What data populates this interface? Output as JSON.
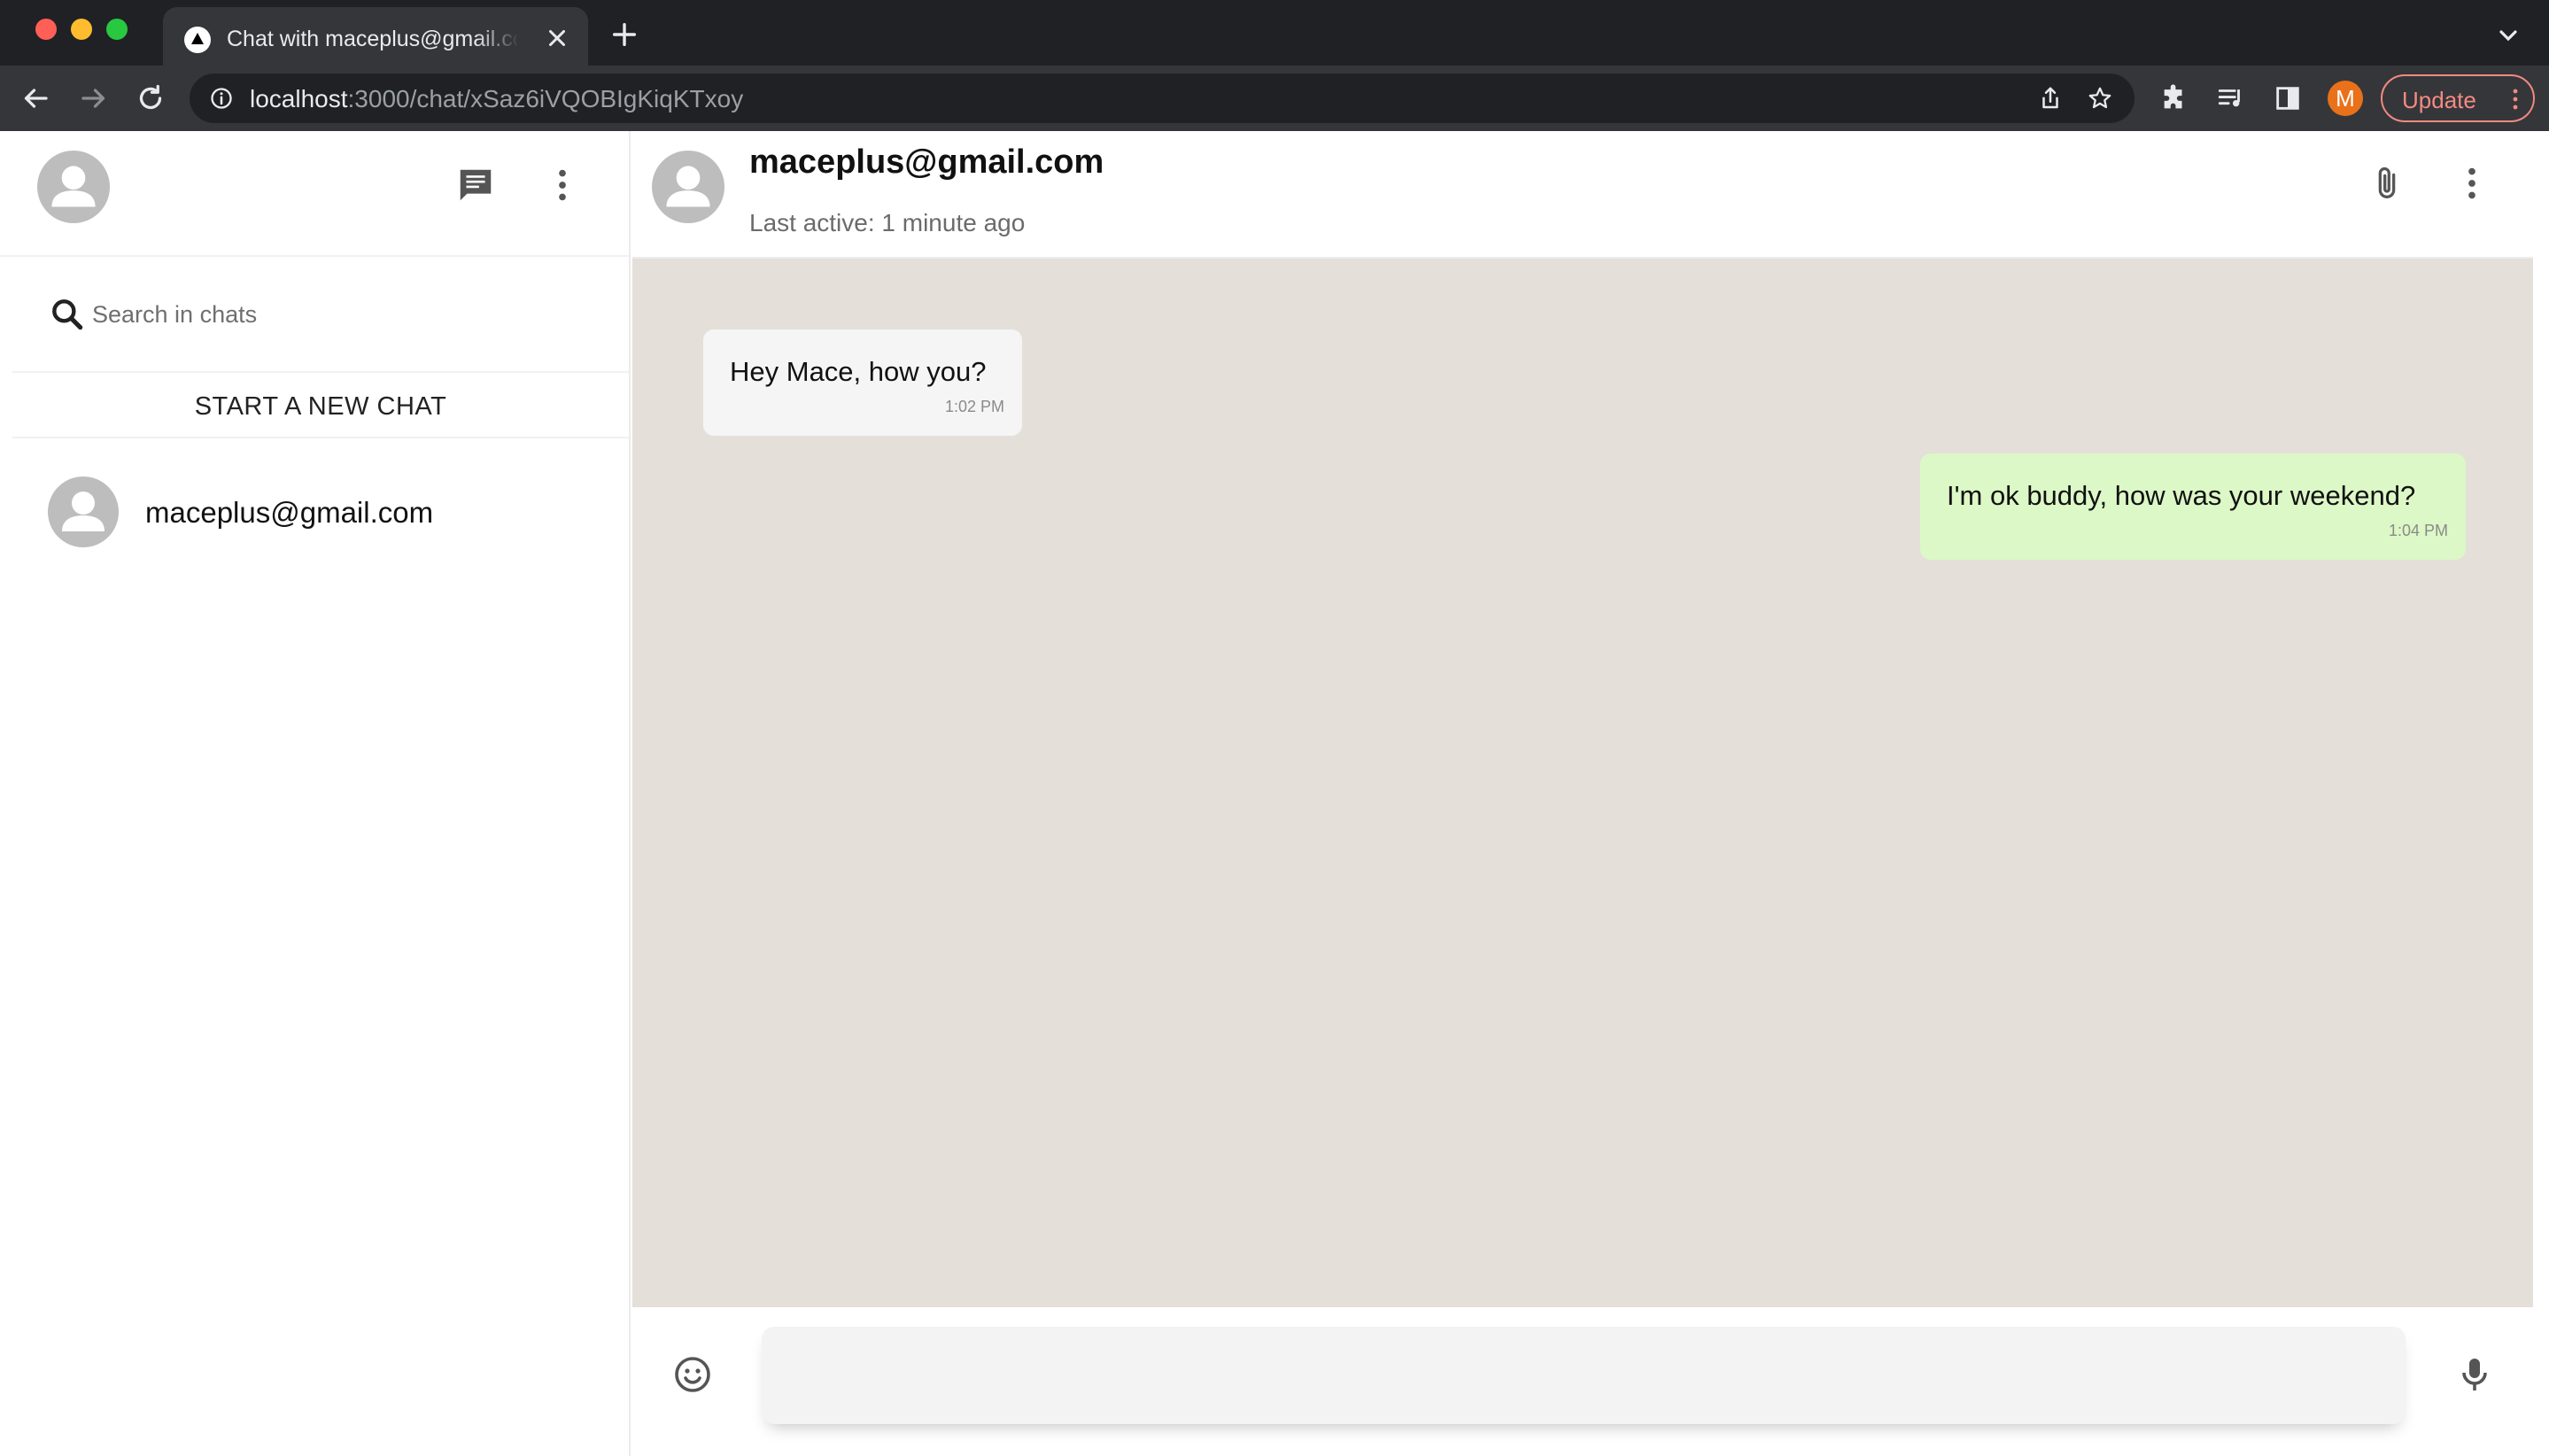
{
  "browser": {
    "tab_title": "Chat with maceplus@gmail.com",
    "url_host": "localhost",
    "url_rest": ":3000/chat/xSaz6iVQOBIgKiqKTxoy",
    "profile_initial": "M",
    "update_label": "Update",
    "colors": {
      "chrome_dark": "#202124",
      "toolbar": "#35363a",
      "update_accent": "#f28b82",
      "profile_bg": "#e8711a"
    }
  },
  "sidebar": {
    "search_placeholder": "Search in chats",
    "new_chat_label": "START A NEW CHAT",
    "chats": [
      {
        "name": "maceplus@gmail.com"
      }
    ]
  },
  "chat": {
    "contact_name": "maceplus@gmail.com",
    "last_active": "Last active: 1 minute ago",
    "messages": [
      {
        "direction": "received",
        "text": "Hey Mace, how you?",
        "time": "1:02 PM"
      },
      {
        "direction": "sent",
        "text": "I'm ok buddy, how was your weekend?",
        "time": "1:04 PM"
      }
    ],
    "composer_value": "",
    "colors": {
      "background": "#e4dfd9",
      "received_bubble": "#f5f5f5",
      "sent_bubble": "#dcf8c6"
    }
  },
  "icons": {
    "sidebar_header": [
      "chat-icon",
      "more-vert-icon"
    ],
    "chat_header": [
      "attach-icon",
      "more-vert-icon"
    ],
    "composer": [
      "emoji-icon",
      "mic-icon"
    ]
  }
}
